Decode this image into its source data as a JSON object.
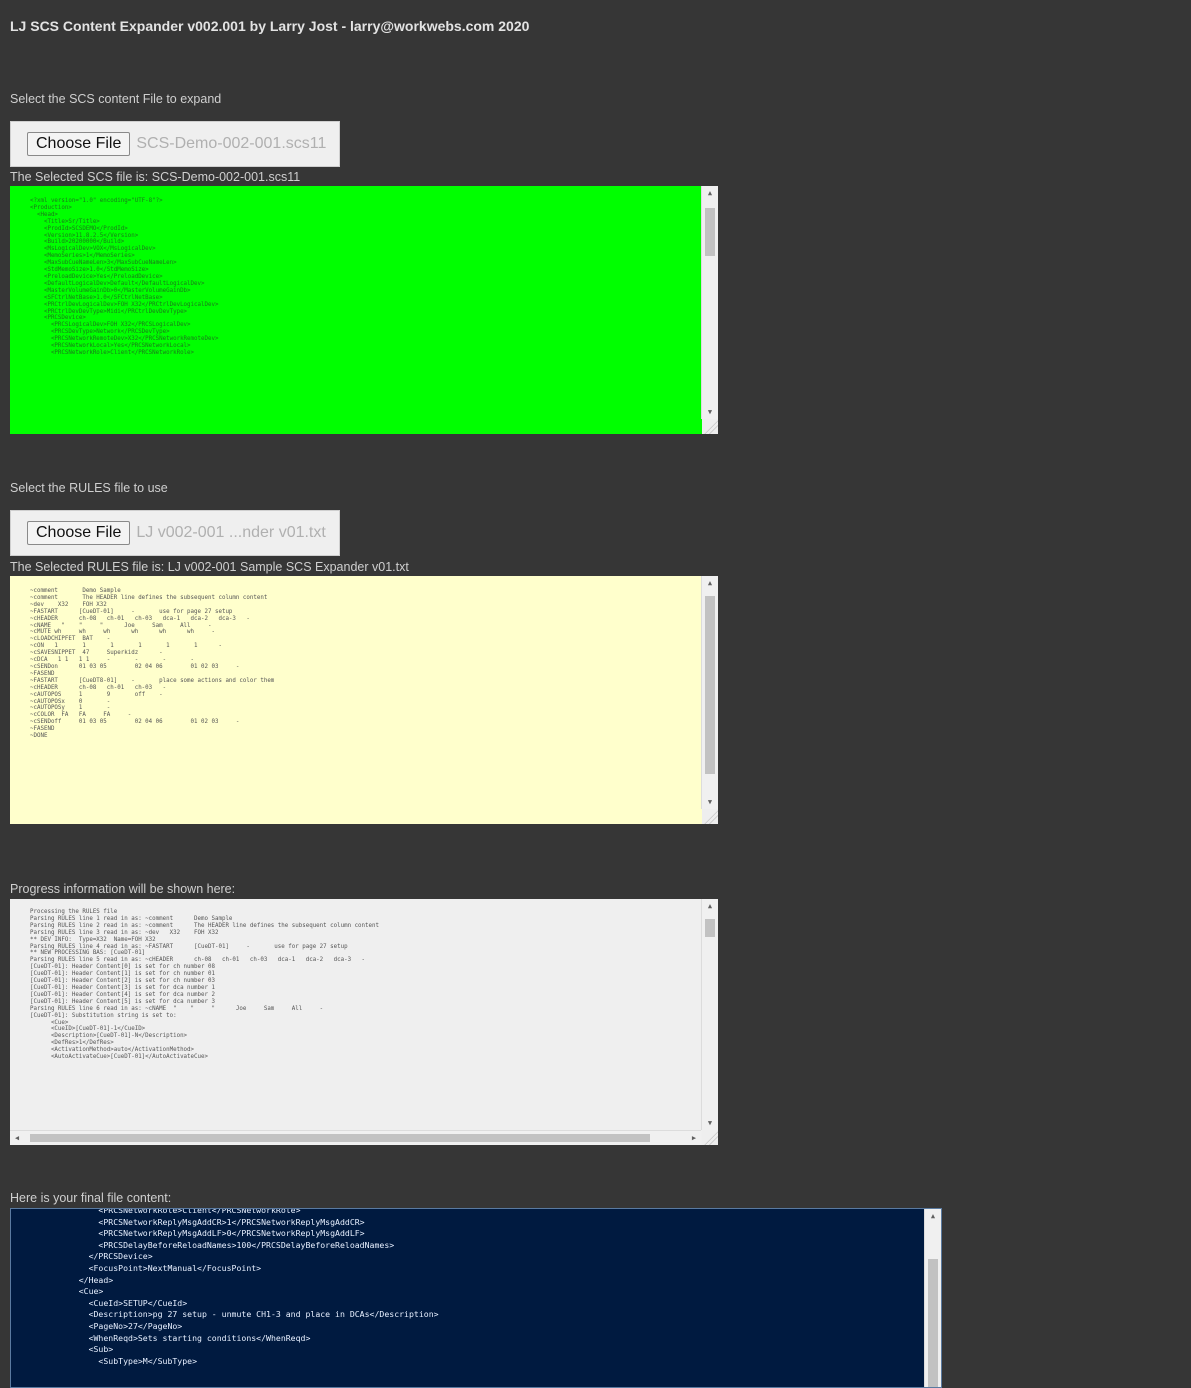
{
  "header": {
    "title": "LJ SCS Content Expander v002.001 by Larry Jost - larry@workwebs.com 2020"
  },
  "scs_section": {
    "prompt": "Select the SCS content File to expand",
    "button_label": "Choose File",
    "file_name": "SCS-Demo-002-001.scs11",
    "selected_text": "The Selected SCS file is: SCS-Demo-002-001.scs11",
    "colors": {
      "background": "#00ff00",
      "text": "#1a7a1a"
    },
    "content": "<?xml version=\"1.0\" encoding=\"UTF-8\"?>\n<Production>\n  <Head>\n    <Title>Sr/Title>\n    <ProdId>SCSDEMO</ProdId>\n    <Version>11.8.2.5</Version>\n    <Build>20200000</Build>\n    <MsLogicalDev>VOX</MsLogicalDev>\n    <MemoSeries>1</MemoSeries>\n    <MaxSubCueNameLen>3</MaxSubCueNameLen>\n    <StdMemoSize>1.0</StdMemoSize>\n    <PreloadDevice>Yes</PreloadDevice>\n    <DefaultLogicalDev>Default</DefaultLogicalDev>\n    <MasterVolumeGainDb>0</MasterVolumeGainDb>\n    <SFCtrlNetBase>1.0</SFCtrlNetBase>\n    <PRCtrlDevLogicalDev>FOH X32</PRCtrlDevLogicalDev>\n    <PRCtrlDevDevType>Midi</PRCtrlDevDevType>\n    <PRCSDevice>\n      <PRCSLogicalDev>FOH X32</PRCSLogicalDev>\n      <PRCSDevType>Network</PRCSDevType>\n      <PRCSNetworkRemoteDev>X32</PRCSNetworkRemoteDev>\n      <PRCSNetworkLocal>Yes</PRCSNetworkLocal>\n      <PRCSNetworkRole>Client</PRCSNetworkRole>"
  },
  "rules_section": {
    "prompt": "Select the RULES file to use",
    "button_label": "Choose File",
    "file_name": "LJ v002-001 ...nder v01.txt",
    "selected_text": "The Selected RULES file is: LJ v002-001 Sample SCS Expander v01.txt",
    "colors": {
      "background": "#ffffcc",
      "text": "#555555"
    },
    "content": "~comment       Demo Sample\n~comment       The HEADER line defines the subsequent column content\n~dev    X32    FOH X32\n~FASTART      [CueDT-01]     -       use for page 27 setup\n~cHEADER      ch-08   ch-01   ch-03   dca-1   dca-2   dca-3   -\n~cNAME   \"    \"     \"      Joe     Sam     All     -\n~cMUTE wh     wh     wh      wh      wh      wh     -\n~cLOADCHIPFET  BAT    -\n~cON   1       1       1       1       1       1      -\n~cSAVESNIPPET  47     Superkidz      -\n~cDCA   1 1   1 1     -       -       -       -\n~cSENDon      01 03 05        02 04 06        01 02 03     -\n~FASEND\n~FASTART      [CueDT8-01]    -       place some actions and color them\n~cHEADER      ch-08   ch-01   ch-03   -\n~cAUTOPOS     1       9       off    -\n~cAUTOPOSx    0       -\n~cAUTOPOSy    1       -\n~cCOLOR  FA   FA     FA     -\n~cSENDoff     01 03 05        02 04 06        01 02 03     -\n~FASEND\n~DONE"
  },
  "progress_section": {
    "prompt": "Progress information will be shown here:",
    "colors": {
      "background": "#efefef",
      "text": "#555555"
    },
    "content": "Processing the RULES file\nParsing RULES line 1 read in as: ~comment      Demo Sample\nParsing RULES line 2 read in as: ~comment      The HEADER line defines the subsequent column content\nParsing RULES line 3 read in as: ~dev   X32    FOH X32\n** DEV INFO:  Type=X32  Name=FOH X32\nParsing RULES line 4 read in as: ~FASTART      [CueDT-01]     -       use for page 27 setup\n** NEW PROCESSING BAS: [CueDT-01]\nParsing RULES line 5 read in as: ~cHEADER      ch-08   ch-01   ch-03   dca-1   dca-2   dca-3   -\n[CueDT-01]: Header Content[0] is set for ch number 08\n[CueDT-01]: Header Content[1] is set for ch number 01\n[CueDT-01]: Header Content[2] is set for ch number 03\n[CueDT-01]: Header Content[3] is set for dca number 1\n[CueDT-01]: Header Content[4] is set for dca number 2\n[CueDT-01]: Header Content[5] is set for dca number 3\nParsing RULES line 6 read in as: ~cNAME  \"    \"     \"      Joe     Sam     All     -\n[CueDT-01]: Substitution string is set to:\n      <Cue>\n      <CueID>[CueDT-01]-1</CueID>\n      <Description>[CueDT-01]-N</Description>\n      <DefRes>1</DefRes>\n      <ActivationMethod>auto</ActivationMethod>\n      <AutoActivateCue>[CueDT-01]</AutoActivateCue>"
  },
  "final_section": {
    "prompt": "Here is your final file content:",
    "colors": {
      "background": "#001a40",
      "text": "#e7f0ff"
    },
    "content": "        <PRCSNetworkRole>Client</PRCSNetworkRole>\n        <PRCSNetworkReplyMsgAddCR>1</PRCSNetworkReplyMsgAddCR>\n        <PRCSNetworkReplyMsgAddLF>0</PRCSNetworkReplyMsgAddLF>\n        <PRCSDelayBeforeReloadNames>100</PRCSDelayBeforeReloadNames>\n      </PRCSDevice>\n      <FocusPoint>NextManual</FocusPoint>\n    </Head>\n    <Cue>\n      <CueId>SETUP</CueId>\n      <Description>pg 27 setup - unmute CH1-3 and place in DCAs</Description>\n      <PageNo>27</PageNo>\n      <WhenReqd>Sets starting conditions</WhenReqd>\n      <Sub>\n        <SubType>M</SubType>"
  }
}
